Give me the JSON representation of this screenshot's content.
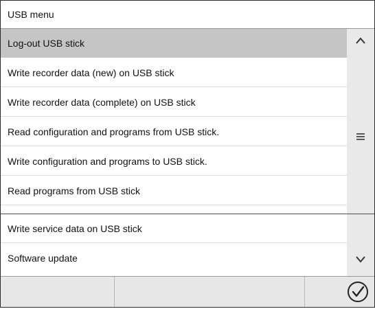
{
  "window": {
    "title": "USB menu"
  },
  "menu": {
    "items": [
      {
        "label": "Log-out USB stick"
      },
      {
        "label": "Write recorder data (new) on USB stick"
      },
      {
        "label": "Write recorder data (complete) on USB stick"
      },
      {
        "label": "Read configuration and programs from USB stick."
      },
      {
        "label": "Write configuration and programs to USB stick."
      },
      {
        "label": "Read programs from USB stick"
      },
      {
        "label": "Write service data on USB stick"
      },
      {
        "label": "Software update"
      }
    ],
    "selected_index": 0
  },
  "scrollbar": {
    "up_icon": "chevron-up-icon",
    "middle_icon": "menu-lines-icon",
    "down_icon": "chevron-down-icon"
  },
  "footer": {
    "confirm_icon": "checkmark-circle-icon"
  },
  "colors": {
    "selected_row": "#c5c5c5",
    "scrollbar_bg": "#e9e9e9",
    "footer_bg": "#e7e7e7",
    "border": "#2a2a2a"
  }
}
